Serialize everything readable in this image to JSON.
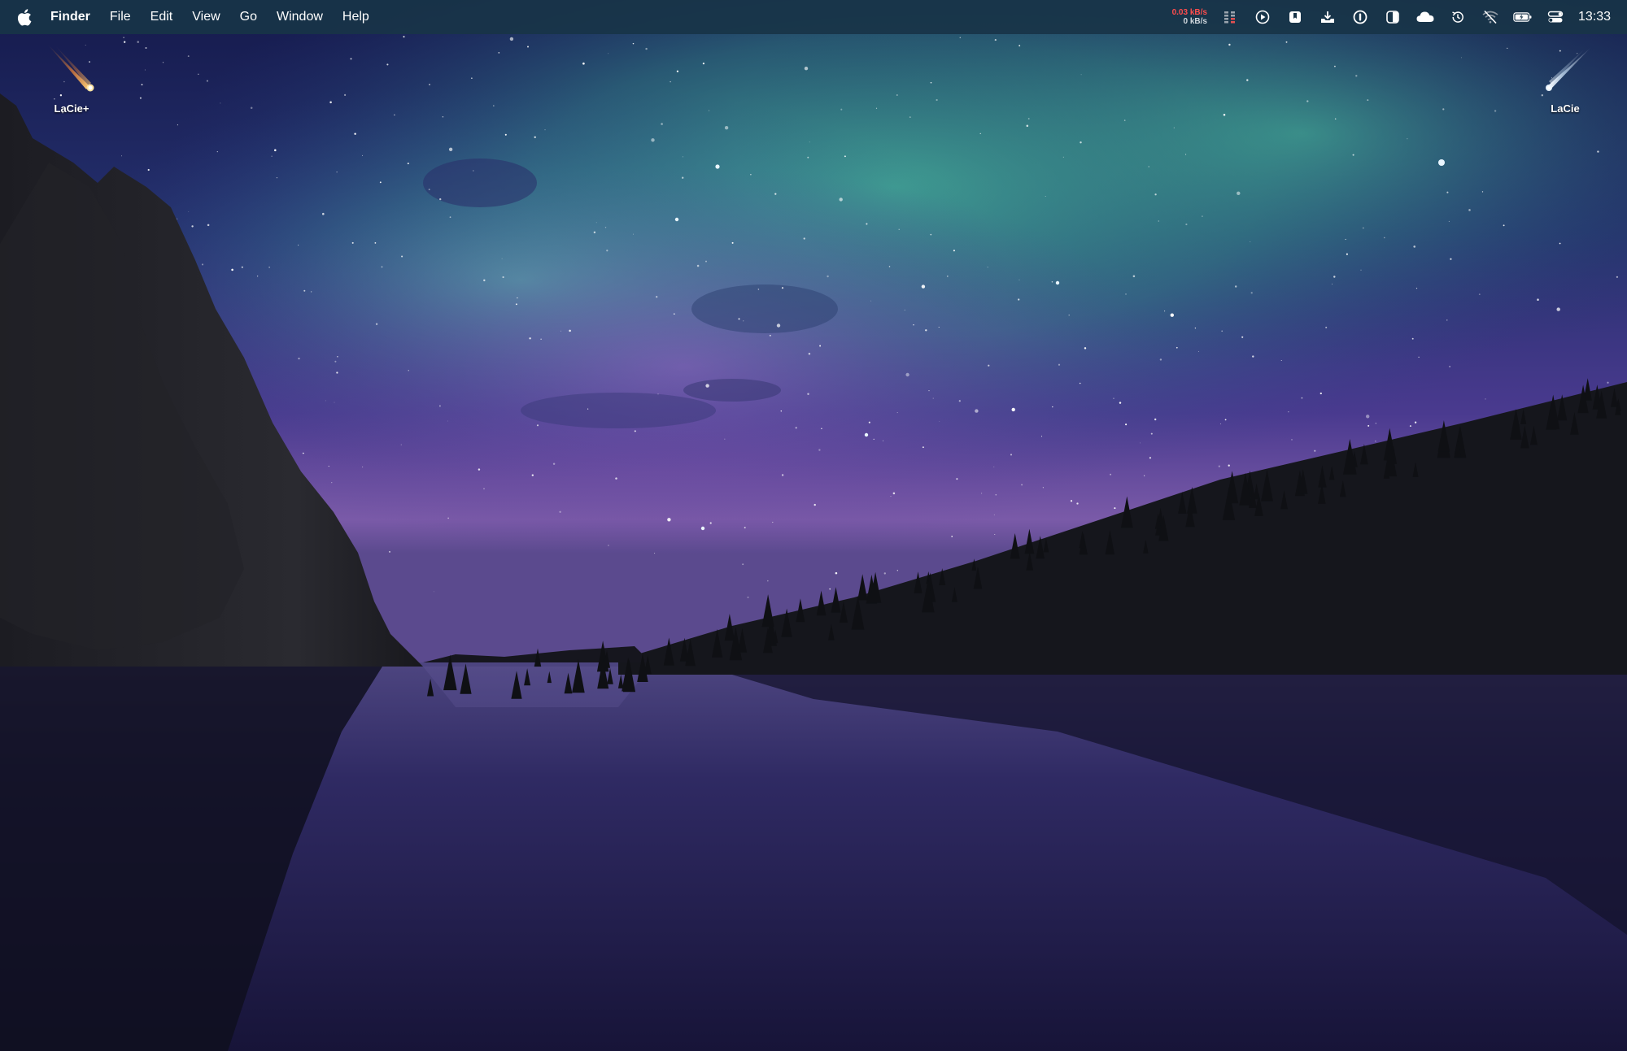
{
  "menubar": {
    "apple_icon": "apple-logo-icon",
    "app_name": "Finder",
    "menus": [
      "File",
      "Edit",
      "View",
      "Go",
      "Window",
      "Help"
    ],
    "network": {
      "upload": "0.03 kB/s",
      "download": "0 kB/s"
    },
    "status_icons": [
      "memory-bars-icon",
      "play-circle-icon",
      "bookmark-app-icon",
      "download-tray-icon",
      "password-manager-icon",
      "contrast-toggle-icon",
      "cloud-icon",
      "time-machine-icon",
      "wifi-off-icon",
      "battery-charging-icon",
      "control-center-icon"
    ],
    "clock": "13:33"
  },
  "desktop_icons": [
    {
      "label": "LaCie+",
      "icon": "comet-drive-icon-orange"
    },
    {
      "label": "LaCie",
      "icon": "comet-drive-icon-white"
    }
  ],
  "colors": {
    "menubar_bg": "#183448",
    "network_up": "#ff4d4d",
    "sky_top": "#1b1f57",
    "aurora": "#3fb79a",
    "horizon": "#6a4aa0",
    "lake": "#241f52"
  }
}
